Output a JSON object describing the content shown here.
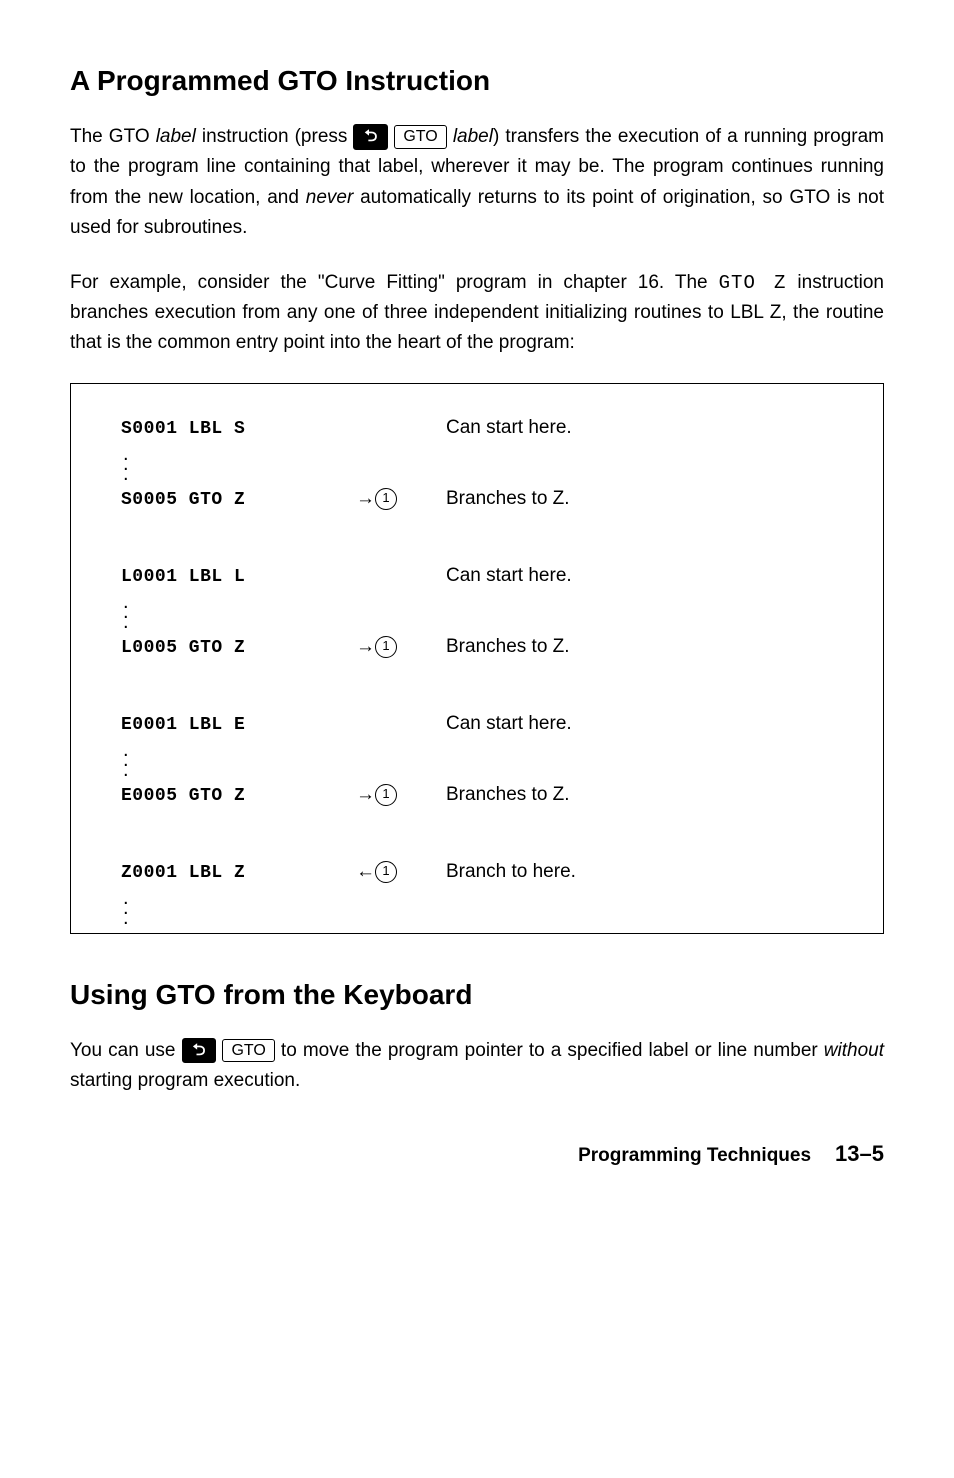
{
  "section1": {
    "heading": "A Programmed GTO Instruction",
    "para1_a": "The GTO ",
    "para1_b": " instruction (press ",
    "para1_c": ") transfers the execution of a running program to the program line containing that label, wherever it may be. The program continues running from the new location, and ",
    "para1_d": " automatically returns to its point of origination, so GTO is not used for subroutines.",
    "label_italic": "label",
    "never_italic": "never",
    "key_shift": "⮌",
    "key_gto": "GTO",
    "para2_a": "For example, consider the \"Curve Fitting\" program in chapter 16. The ",
    "para2_gto": "GTO Z",
    "para2_b": " instruction branches execution from any one of three independent initializing routines to LBL Z, the routine that is the common entry point into the heart of the program:"
  },
  "example": {
    "s1_code": "S0001 LBL S",
    "s1_desc": "Can start here.",
    "s5_code": "S0005 GTO Z",
    "s5_desc": "Branches to Z.",
    "l1_code": "L0001 LBL L",
    "l1_desc": "Can start here.",
    "l5_code": "L0005 GTO Z",
    "l5_desc": "Branches to Z.",
    "e1_code": "E0001 LBL E",
    "e1_desc": "Can start here.",
    "e5_code": "E0005 GTO Z",
    "e5_desc": "Branches to Z.",
    "z1_code": "Z0001 LBL Z",
    "z1_desc": "Branch to here.",
    "arrow_right": "→",
    "arrow_left": "←",
    "circled1": "1"
  },
  "section2": {
    "heading": "Using GTO from the Keyboard",
    "para_a": "You can use ",
    "para_b": " to move the program pointer to a specified label or line number ",
    "without_italic": "without",
    "para_c": " starting program execution.",
    "key_shift": "⮌",
    "key_gto": "GTO"
  },
  "footer": {
    "title": "Programming Techniques",
    "page": "13–5"
  }
}
